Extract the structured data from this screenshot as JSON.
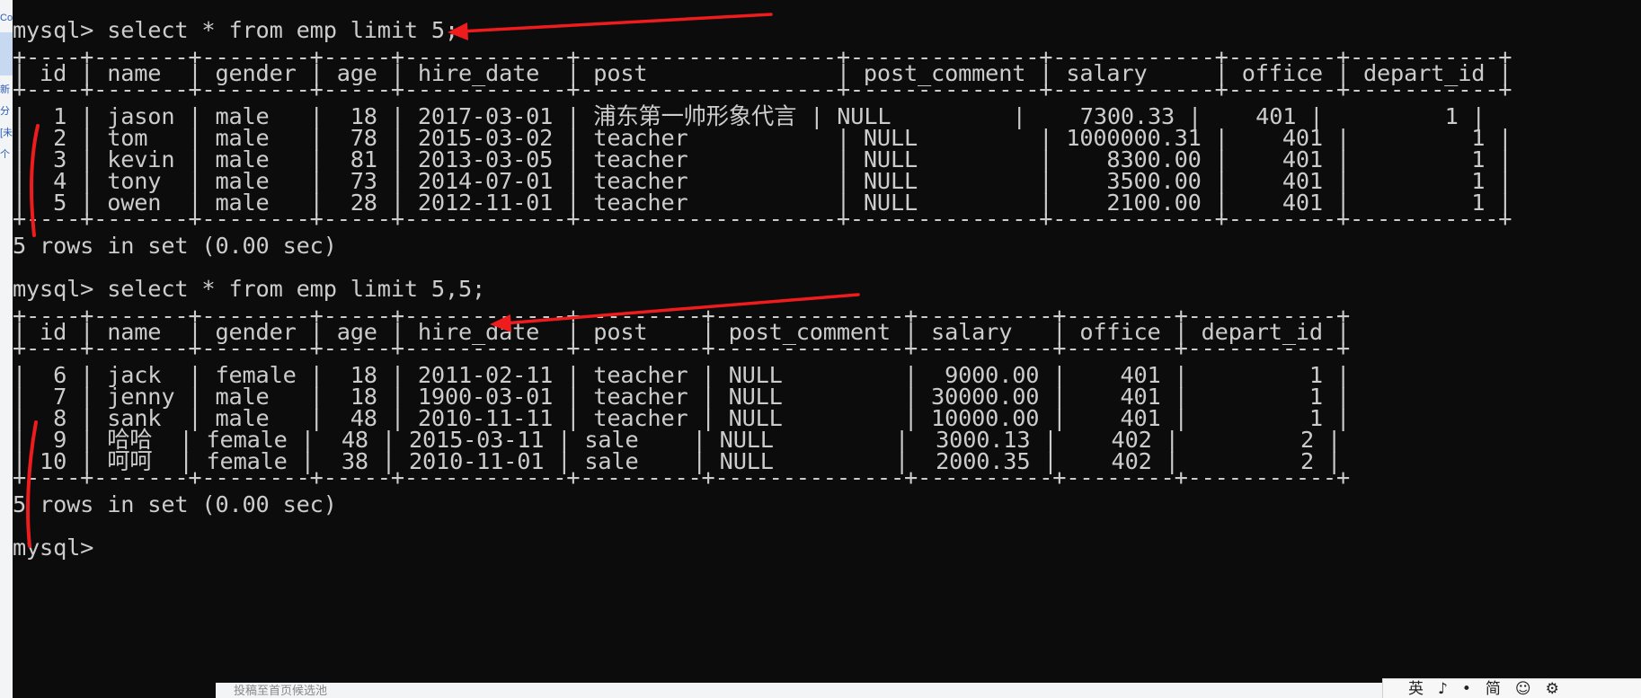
{
  "background_page": {
    "edge_text": [
      "Co",
      "新",
      "分",
      "[未",
      "个"
    ],
    "bottom_text": "投稿至首页候选池"
  },
  "terminal": {
    "lines": [
      "mysql> select * from emp limit 5;",
      "+----+-------+--------+-----+------------+-------------------+--------------+------------+--------+-----------+",
      "| id | name  | gender | age | hire_date  | post              | post_comment | salary     | office | depart_id |",
      "+----+-------+--------+-----+------------+-------------------+--------------+------------+--------+-----------+",
      "|  1 | jason | male   |  18 | 2017-03-01 | 浦东第一帅形象代言 | NULL         |    7300.33 |    401 |         1 |",
      "|  2 | tom   | male   |  78 | 2015-03-02 | teacher           | NULL         | 1000000.31 |    401 |         1 |",
      "|  3 | kevin | male   |  81 | 2013-03-05 | teacher           | NULL         |    8300.00 |    401 |         1 |",
      "|  4 | tony  | male   |  73 | 2014-07-01 | teacher           | NULL         |    3500.00 |    401 |         1 |",
      "|  5 | owen  | male   |  28 | 2012-11-01 | teacher           | NULL         |    2100.00 |    401 |         1 |",
      "+----+-------+--------+-----+------------+-------------------+--------------+------------+--------+-----------+",
      "5 rows in set (0.00 sec)",
      "",
      "mysql> select * from emp limit 5,5;",
      "+----+-------+--------+-----+------------+---------+--------------+----------+--------+-----------+",
      "| id | name  | gender | age | hire_date  | post    | post_comment | salary   | office | depart_id |",
      "+----+-------+--------+-----+------------+---------+--------------+----------+--------+-----------+",
      "|  6 | jack  | female |  18 | 2011-02-11 | teacher | NULL         |  9000.00 |    401 |         1 |",
      "|  7 | jenny | male   |  18 | 1900-03-01 | teacher | NULL         | 30000.00 |    401 |         1 |",
      "|  8 | sank  | male   |  48 | 2010-11-11 | teacher | NULL         | 10000.00 |    401 |         1 |",
      "|  9 | 哈哈  | female |  48 | 2015-03-11 | sale    | NULL         |  3000.13 |    402 |         2 |",
      "| 10 | 呵呵  | female |  38 | 2010-11-01 | sale    | NULL         |  2000.35 |    402 |         2 |",
      "+----+-------+--------+-----+------------+---------+--------------+----------+--------+-----------+",
      "5 rows in set (0.00 sec)",
      "",
      "mysql>"
    ]
  },
  "taskbar_ime": {
    "items": [
      "英",
      "♪",
      "•",
      "简",
      "☺",
      "⚙"
    ]
  },
  "colors": {
    "terminal_bg": "#0c0c0c",
    "terminal_text": "#cccccc",
    "annotation_red": "#ee1c1c"
  },
  "icons": [
    "settings-icon",
    "emoji-icon",
    "music-note-icon"
  ]
}
